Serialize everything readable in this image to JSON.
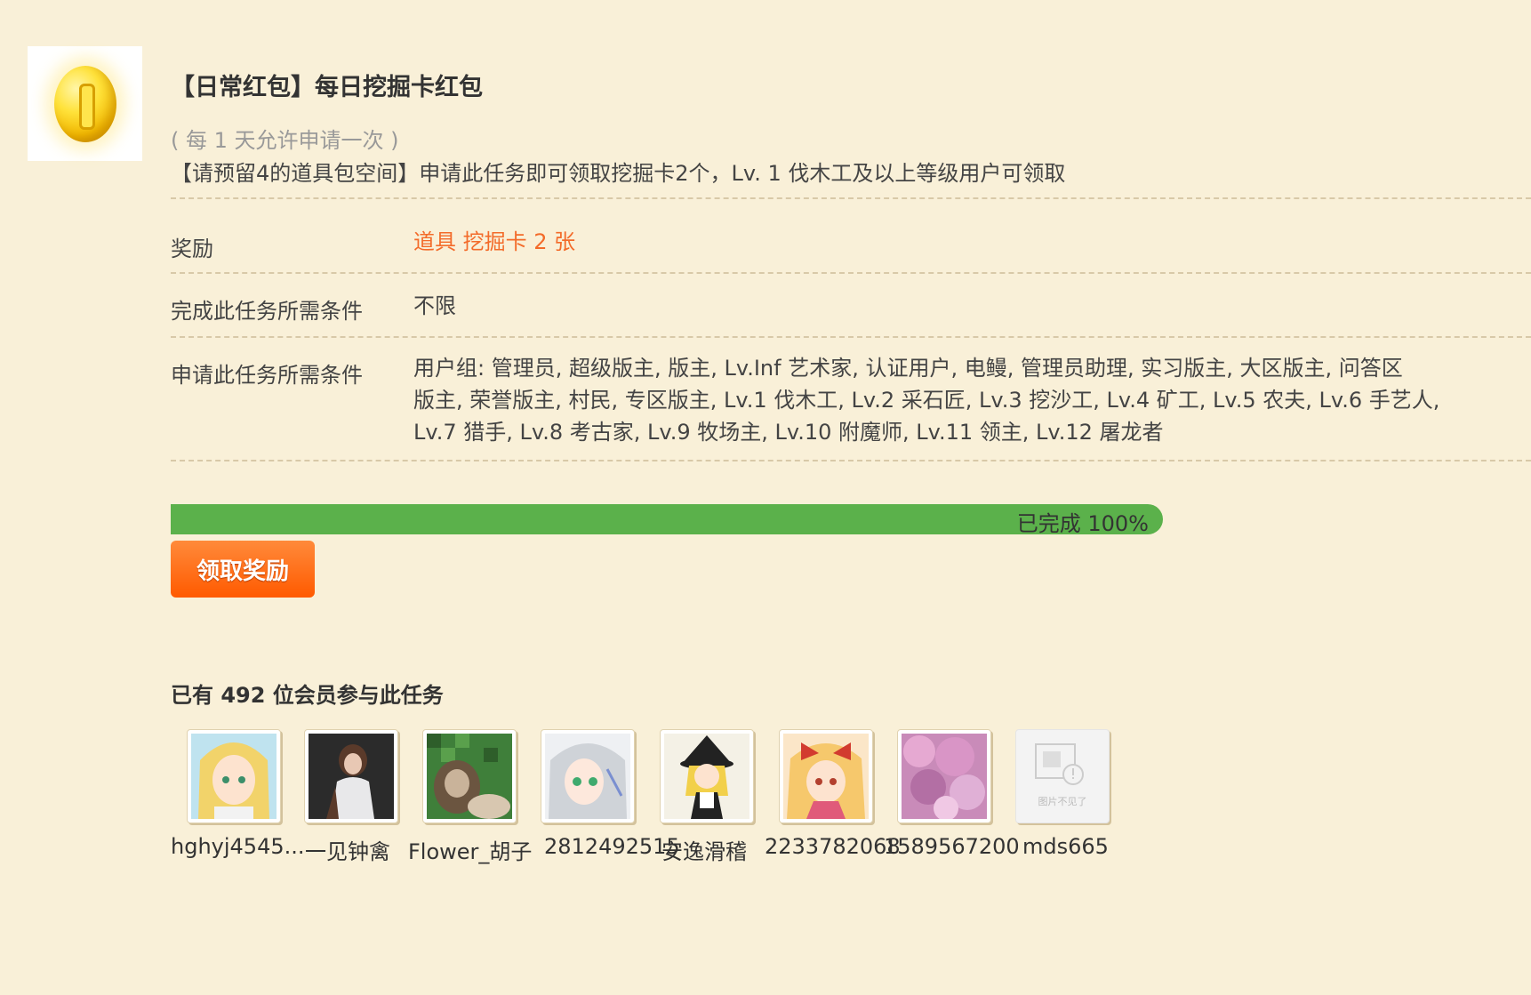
{
  "task": {
    "title": "【日常红包】每日挖掘卡红包",
    "frequency": "( 每 1 天允许申请一次 )",
    "description": "【请预留4的道具包空间】申请此任务即可领取挖掘卡2个，Lv. 1 伐木工及以上等级用户可领取"
  },
  "details": {
    "reward_label": "奖励",
    "reward_value": "道具 挖掘卡 2 张",
    "complete_label": "完成此任务所需条件",
    "complete_value": "不限",
    "apply_label": "申请此任务所需条件",
    "apply_lines": [
      "用户组: 管理员, 超级版主, 版主, Lv.Inf 艺术家, 认证用户, 电鳗, 管理员助理, 实习版主, 大区版主, 问答区",
      "版主, 荣誉版主, 村民, 专区版主, Lv.1 伐木工, Lv.2 采石匠, Lv.3 挖沙工, Lv.4 矿工, Lv.5 农夫, Lv.6 手艺人,",
      "Lv.7 猎手, Lv.8 考古家, Lv.9 牧场主, Lv.10 附魔师, Lv.11 领主, Lv.12 屠龙者"
    ]
  },
  "progress": {
    "text": "已完成 100%",
    "percent": 100,
    "color": "#5bb14b"
  },
  "claim_button": "领取奖励",
  "participants": {
    "heading": "已有 492 位会员参与此任务",
    "users": [
      {
        "name": "hghyj4545..."
      },
      {
        "name": "一见钟禽"
      },
      {
        "name": "Flower_胡子"
      },
      {
        "name": "2812492515"
      },
      {
        "name": "安逸滑稽"
      },
      {
        "name": "2233782068"
      },
      {
        "name": "1589567200"
      },
      {
        "name": "mds665"
      }
    ],
    "missing_image_text": "图片不见了"
  },
  "colors": {
    "background": "#f9f0d8",
    "accent": "#f36b2a",
    "button": "#ff6a10"
  }
}
